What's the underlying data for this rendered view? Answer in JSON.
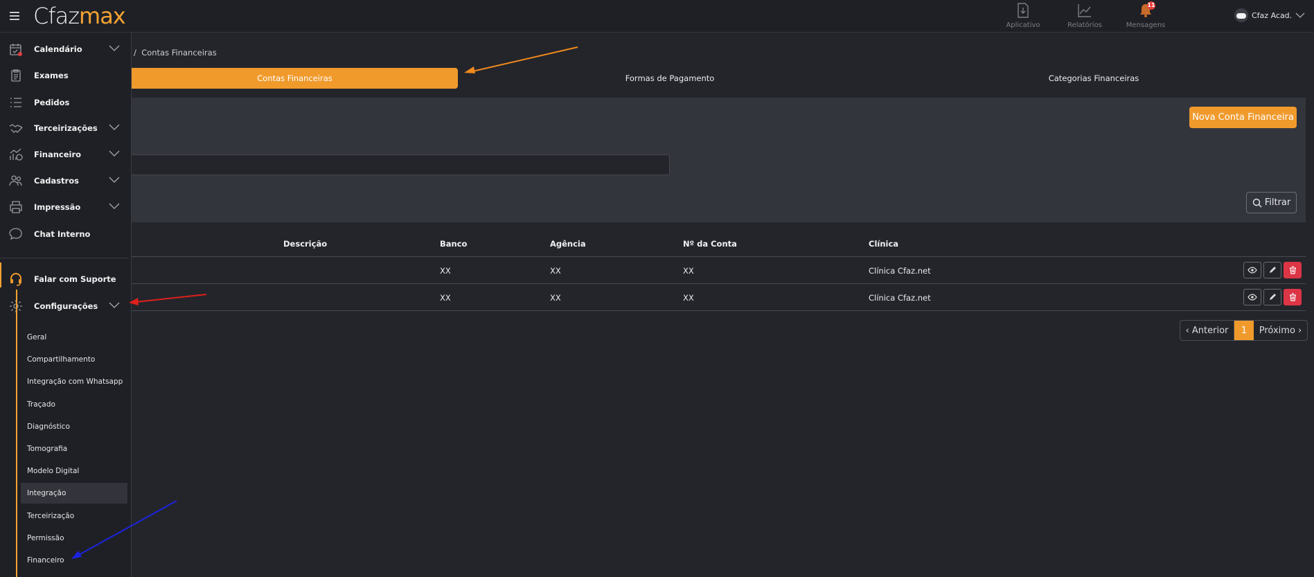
{
  "app": {
    "logo_part1": "Cfaz",
    "logo_part2": "max"
  },
  "topbar": {
    "items": [
      {
        "label": "Aplicativo",
        "icon": "download-doc-icon"
      },
      {
        "label": "Relatórios",
        "icon": "trend-chart-icon"
      },
      {
        "label": "Mensagens",
        "icon": "bell-icon",
        "badge": "11"
      }
    ],
    "user": "Cfaz Acad."
  },
  "sidebar": {
    "items": [
      {
        "label": "Calendário",
        "icon": "calendar-icon",
        "expandable": true
      },
      {
        "label": "Exames",
        "icon": "clipboard-icon",
        "expandable": false
      },
      {
        "label": "Pedidos",
        "icon": "list-icon",
        "expandable": false
      },
      {
        "label": "Terceirizações",
        "icon": "handshake-icon",
        "expandable": true
      },
      {
        "label": "Financeiro",
        "icon": "finance-chart-icon",
        "expandable": true
      },
      {
        "label": "Cadastros",
        "icon": "users-icon",
        "expandable": true
      },
      {
        "label": "Impressão",
        "icon": "printer-icon",
        "expandable": true
      },
      {
        "label": "Chat Interno",
        "icon": "chat-icon",
        "expandable": false
      }
    ],
    "support": "Falar com Suporte",
    "config": "Configurações",
    "config_items": [
      "Geral",
      "Compartilhamento",
      "Integração com Whatsapp",
      "Traçado",
      "Diagnóstico",
      "Tomografia",
      "Modelo Digital",
      "Integração",
      "Terceirização",
      "Permissão",
      "Financeiro"
    ]
  },
  "breadcrumb": {
    "sep": "/",
    "current": "Contas Financeiras"
  },
  "tabs": [
    "Contas Financeiras",
    "Formas de Pagamento",
    "Categorias Financeiras"
  ],
  "buttons": {
    "new_account": "Nova Conta Financeira",
    "filter": "Filtrar"
  },
  "table": {
    "headers": [
      "Descrição",
      "Banco",
      "Agência",
      "Nº da Conta",
      "Clínica"
    ],
    "rows": [
      {
        "banco": "XX",
        "agencia": "XX",
        "conta": "XX",
        "clinica": "Clínica Cfaz.net"
      },
      {
        "banco": "XX",
        "agencia": "XX",
        "conta": "XX",
        "clinica": "Clínica Cfaz.net"
      }
    ]
  },
  "pagination": {
    "prev": "‹ Anterior",
    "current": "1",
    "next": "Próximo ›"
  },
  "colors": {
    "accent": "#f09a2c",
    "danger": "#dc3545",
    "bg": "#24252b",
    "annotation_orange": "#f08a1c",
    "annotation_red": "#e0201c",
    "annotation_blue": "#1c24e0"
  }
}
